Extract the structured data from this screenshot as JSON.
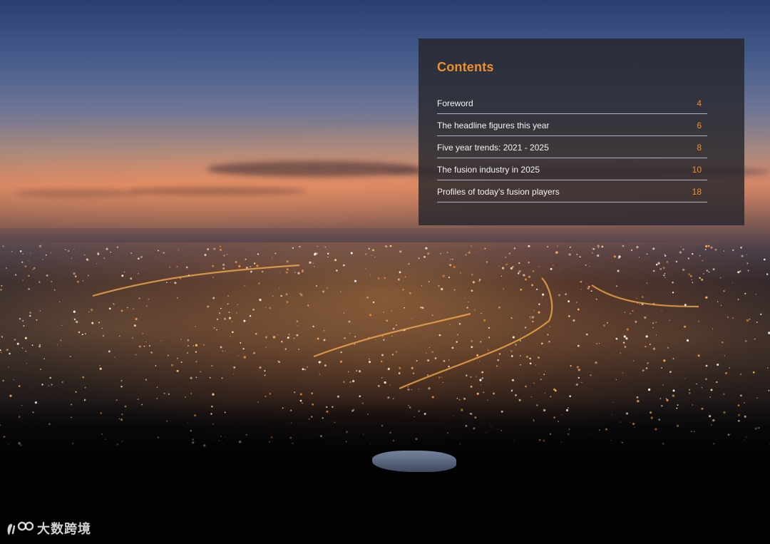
{
  "contents": {
    "title": "Contents",
    "items": [
      {
        "label": "Foreword",
        "page": "4"
      },
      {
        "label": "The headline figures this year",
        "page": "6"
      },
      {
        "label": "Five year trends: 2021 - 2025",
        "page": "8"
      },
      {
        "label": "The fusion industry in 2025",
        "page": "10"
      },
      {
        "label": "Profiles of today's fusion players",
        "page": "18"
      }
    ]
  },
  "watermark": {
    "text": "大数跨境",
    "icon": "logo-icon"
  },
  "colors": {
    "accent": "#ef8f2b",
    "panel": "#26262c",
    "divider": "#a9b4c8"
  }
}
